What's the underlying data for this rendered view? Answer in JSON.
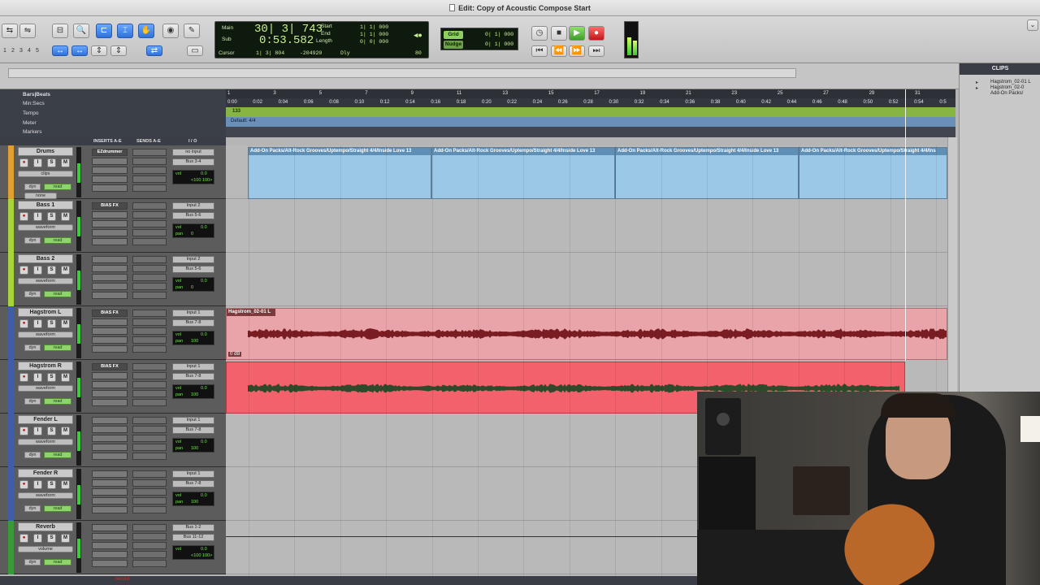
{
  "window": {
    "title": "Edit: Copy of Acoustic Compose Start"
  },
  "toolbar": {
    "zoom_presets": [
      "1",
      "2",
      "3",
      "4",
      "5"
    ],
    "counter": {
      "main_label": "Main",
      "sub_label": "Sub",
      "main_value": "30| 3| 743",
      "sub_value": "0:53.582",
      "start_label": "Start",
      "end_label": "End",
      "length_label": "Length",
      "start_value": "1| 1| 000",
      "end_value": "1| 1| 000",
      "length_value": "0| 0| 000",
      "cursor_label": "Cursor",
      "cursor_value": "1| 3| 804",
      "cursor_extra": "-204920",
      "dly_label": "Dly",
      "zoom_value": "80"
    },
    "grid": {
      "grid_label": "Grid",
      "grid_value": "0| 1| 000",
      "nudge_label": "Nudge",
      "nudge_value": "0| 1| 000"
    }
  },
  "rulers": {
    "names": [
      "Bars|Beats",
      "Min:Secs",
      "Tempo",
      "Meter",
      "Markers"
    ],
    "bar_ticks": [
      "1",
      "3",
      "5",
      "7",
      "9",
      "11",
      "13",
      "15",
      "17",
      "19",
      "21",
      "23",
      "25",
      "27",
      "29",
      "31"
    ],
    "min_ticks": [
      "0:00",
      "0:02",
      "0:04",
      "0:06",
      "0:08",
      "0:10",
      "0:12",
      "0:14",
      "0:16",
      "0:18",
      "0:20",
      "0:22",
      "0:24",
      "0:26",
      "0:28",
      "0:30",
      "0:32",
      "0:34",
      "0:36",
      "0:38",
      "0:40",
      "0:42",
      "0:44",
      "0:46",
      "0:48",
      "0:50",
      "0:52",
      "0:54",
      "0:5"
    ],
    "tempo_value": "133",
    "meter_value": "Default: 4/4"
  },
  "columns": {
    "inserts": "INSERTS A-E",
    "sends": "SENDS A-E",
    "io": "I / O"
  },
  "tracks": [
    {
      "name": "Drums",
      "color": "#e0a030",
      "view": "clips",
      "view2": "none",
      "insert": "EZdrummer",
      "input": "no input",
      "output": "Bus 3-4",
      "vol": "0.0",
      "pan": "<100  100>",
      "pan_label": ""
    },
    {
      "name": "Bass 1",
      "color": "#a7d43a",
      "view": "waveform",
      "view2": "",
      "insert": "BIAS FX",
      "input": "Input 2",
      "output": "Bus 5-6",
      "vol": "0.0",
      "pan": "0",
      "pan_label": "pan"
    },
    {
      "name": "Bass 2",
      "color": "#a7d43a",
      "view": "waveform",
      "view2": "",
      "insert": "",
      "input": "Input 2",
      "output": "Bus 5-6",
      "vol": "0.0",
      "pan": "0",
      "pan_label": "pan"
    },
    {
      "name": "Hagstrom L",
      "color": "#3e5ea8",
      "view": "waveform",
      "view2": "",
      "insert": "BIAS FX",
      "input": "Input 1",
      "output": "Bus 7-8",
      "vol": "0.0",
      "pan": "100",
      "pan_label": "pan"
    },
    {
      "name": "Hagstrom R",
      "color": "#3e5ea8",
      "view": "waveform",
      "view2": "",
      "insert": "BIAS FX",
      "input": "Input 1",
      "output": "Bus 7-8",
      "vol": "0.0",
      "pan": "100",
      "pan_label": "pan"
    },
    {
      "name": "Fender L",
      "color": "#3e5ea8",
      "view": "waveform",
      "view2": "",
      "insert": "",
      "input": "Input 1",
      "output": "Bus 7-8",
      "vol": "0.0",
      "pan": "100",
      "pan_label": "pan"
    },
    {
      "name": "Fender R",
      "color": "#3e5ea8",
      "view": "waveform",
      "view2": "",
      "insert": "",
      "input": "Input 1",
      "output": "Bus 7-8",
      "vol": "0.0",
      "pan": "100",
      "pan_label": "pan"
    },
    {
      "name": "Reverb",
      "color": "#3a9a3a",
      "view": "volume",
      "view2": "",
      "insert": "",
      "input": "Bus 1-2",
      "output": "Bus 11-12",
      "vol": "0.0",
      "pan": "<100  100>",
      "pan_label": ""
    }
  ],
  "track_buttons": {
    "rec": "●",
    "input": "I",
    "solo": "S",
    "mute": "M",
    "dyn": "dyn",
    "read": "read",
    "vol_label": "vol"
  },
  "clips": {
    "drum_clip": "Add-On Packs/Alt-Rock Grooves/Uptempo/Straight 4/4/Inside Love 13",
    "drum_clip_tail": "Add-On Packs/Alt-Rock Grooves/Uptempo/Straight 4/4/Ins",
    "hag_l": "Hagstrom_02-01 L",
    "gain": "0 dB"
  },
  "clips_panel": {
    "title": "CLIPS",
    "items": [
      "Hagstrom_02-01 L",
      "Hagstrom_02-0",
      "Add-On Packs/"
    ]
  },
  "colors": {
    "drum_clip": "#9cc8e8",
    "hag_l_clip": "#e8a4a8",
    "hag_r_clip": "#f2616c",
    "waveform_l": "#7a1d22",
    "waveform_r": "#2e4a2a"
  },
  "status": {
    "text": "record"
  }
}
